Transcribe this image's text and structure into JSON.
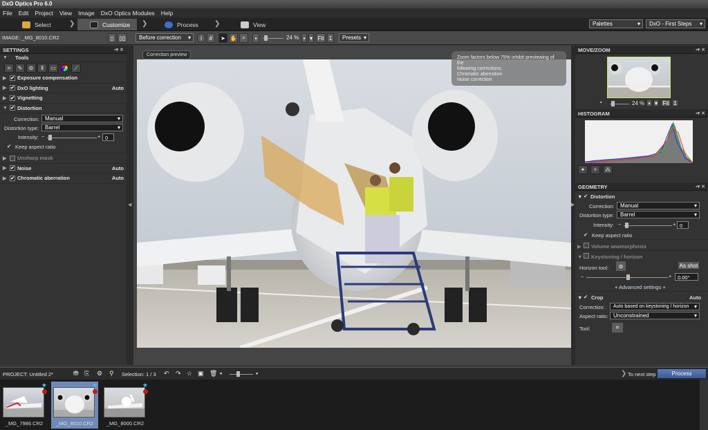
{
  "app": {
    "title": "DxO Optics Pro 6.0"
  },
  "menu": [
    "File",
    "Edit",
    "Project",
    "View",
    "Image",
    "DxO Optics Modules",
    "Help"
  ],
  "tabs": [
    {
      "label": "Select"
    },
    {
      "label": "Customize"
    },
    {
      "label": "Process"
    },
    {
      "label": "View"
    }
  ],
  "workspace": {
    "palettes": "Palettes",
    "preset": "DxO - First Steps"
  },
  "toolbar": {
    "image_label": "IMAGE: _MG_8010.CR2",
    "compare_mode": "Before correction",
    "zoom": "24 %",
    "fit": "Fit",
    "one": "1",
    "presets": "Presets"
  },
  "left": {
    "title": "SETTINGS",
    "tools": "Tools",
    "rows": [
      {
        "label": "Exposure compensation",
        "checked": "✔",
        "auto": ""
      },
      {
        "label": "DxO lighting",
        "checked": "✔",
        "auto": "Auto"
      },
      {
        "label": "Vignetting",
        "checked": "✔",
        "auto": ""
      },
      {
        "label": "Distortion",
        "checked": "✔",
        "auto": ""
      }
    ],
    "distortion": {
      "correction_label": "Correction:",
      "correction": "Manual",
      "type_label": "Distortion type:",
      "type": "Barrel",
      "intensity_label": "Intensity:",
      "intensity": "0",
      "keep_aspect": "Keep aspect ratio"
    },
    "rows2": [
      {
        "label": "Unsharp mask",
        "checked": "",
        "auto": ""
      },
      {
        "label": "Noise",
        "checked": "✔",
        "auto": "Auto"
      },
      {
        "label": "Chromatic aberration",
        "checked": "✔",
        "auto": "Auto"
      }
    ]
  },
  "viewer": {
    "preview_label": "Correction preview",
    "note_l1": "Zoom factors below 75% inhibit previewing of the",
    "note_l2": "following corrections:",
    "note_l3": "Chromatic aberration",
    "note_l4": "Noise correction"
  },
  "right": {
    "move_zoom": "MOVE/ZOOM",
    "zoom": "24 %",
    "fit": "Fit",
    "one": "1",
    "histogram": "HISTOGRAM",
    "geometry": "GEOMETRY",
    "distortion": "Distortion",
    "correction_label": "Correction:",
    "correction": "Manual",
    "type_label": "Distortion type:",
    "type": "Barrel",
    "intensity_label": "Intensity:",
    "intensity": "0",
    "keep_aspect": "Keep aspect ratio",
    "volume": "Volume anamorphosis",
    "keystoning": "Keystoning / horizon",
    "horizon_label": "Horizon tool:",
    "as_shot": "As shot",
    "horizon_value": "0.00°",
    "advanced": "+ Advanced settings +",
    "crop": "Crop",
    "crop_auto": "Auto",
    "crop_correction_label": "Correction:",
    "crop_correction": "Auto based on keystoning / horizon",
    "aspect_label": "Aspect ratio:",
    "aspect": "Unconstrained",
    "tool_label": "Tool:"
  },
  "bottom": {
    "project": "PROJECT:   Untitled 2*",
    "selection": "Selection: 1 / 3",
    "next_step": "To next step",
    "process": "Process"
  },
  "films": [
    {
      "name": "_MG_7986.CR2"
    },
    {
      "name": "_MG_8010.CR2"
    },
    {
      "name": "_MG_8000.CR2"
    }
  ]
}
